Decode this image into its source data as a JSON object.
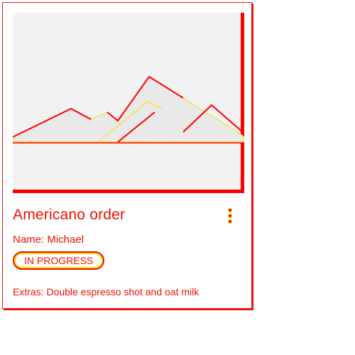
{
  "card": {
    "title": "Americano order",
    "name_line": "Name: Michael",
    "status_badge": "IN PROGRESS",
    "extras_line": "Extras: Double espresso shot and oat milk"
  },
  "icons": {
    "media": "image-placeholder-mountains-icon",
    "menu": "more-vertical-icon"
  },
  "colors": {
    "accent": "#e10000",
    "placeholder_bg": "#f2f2f2"
  }
}
